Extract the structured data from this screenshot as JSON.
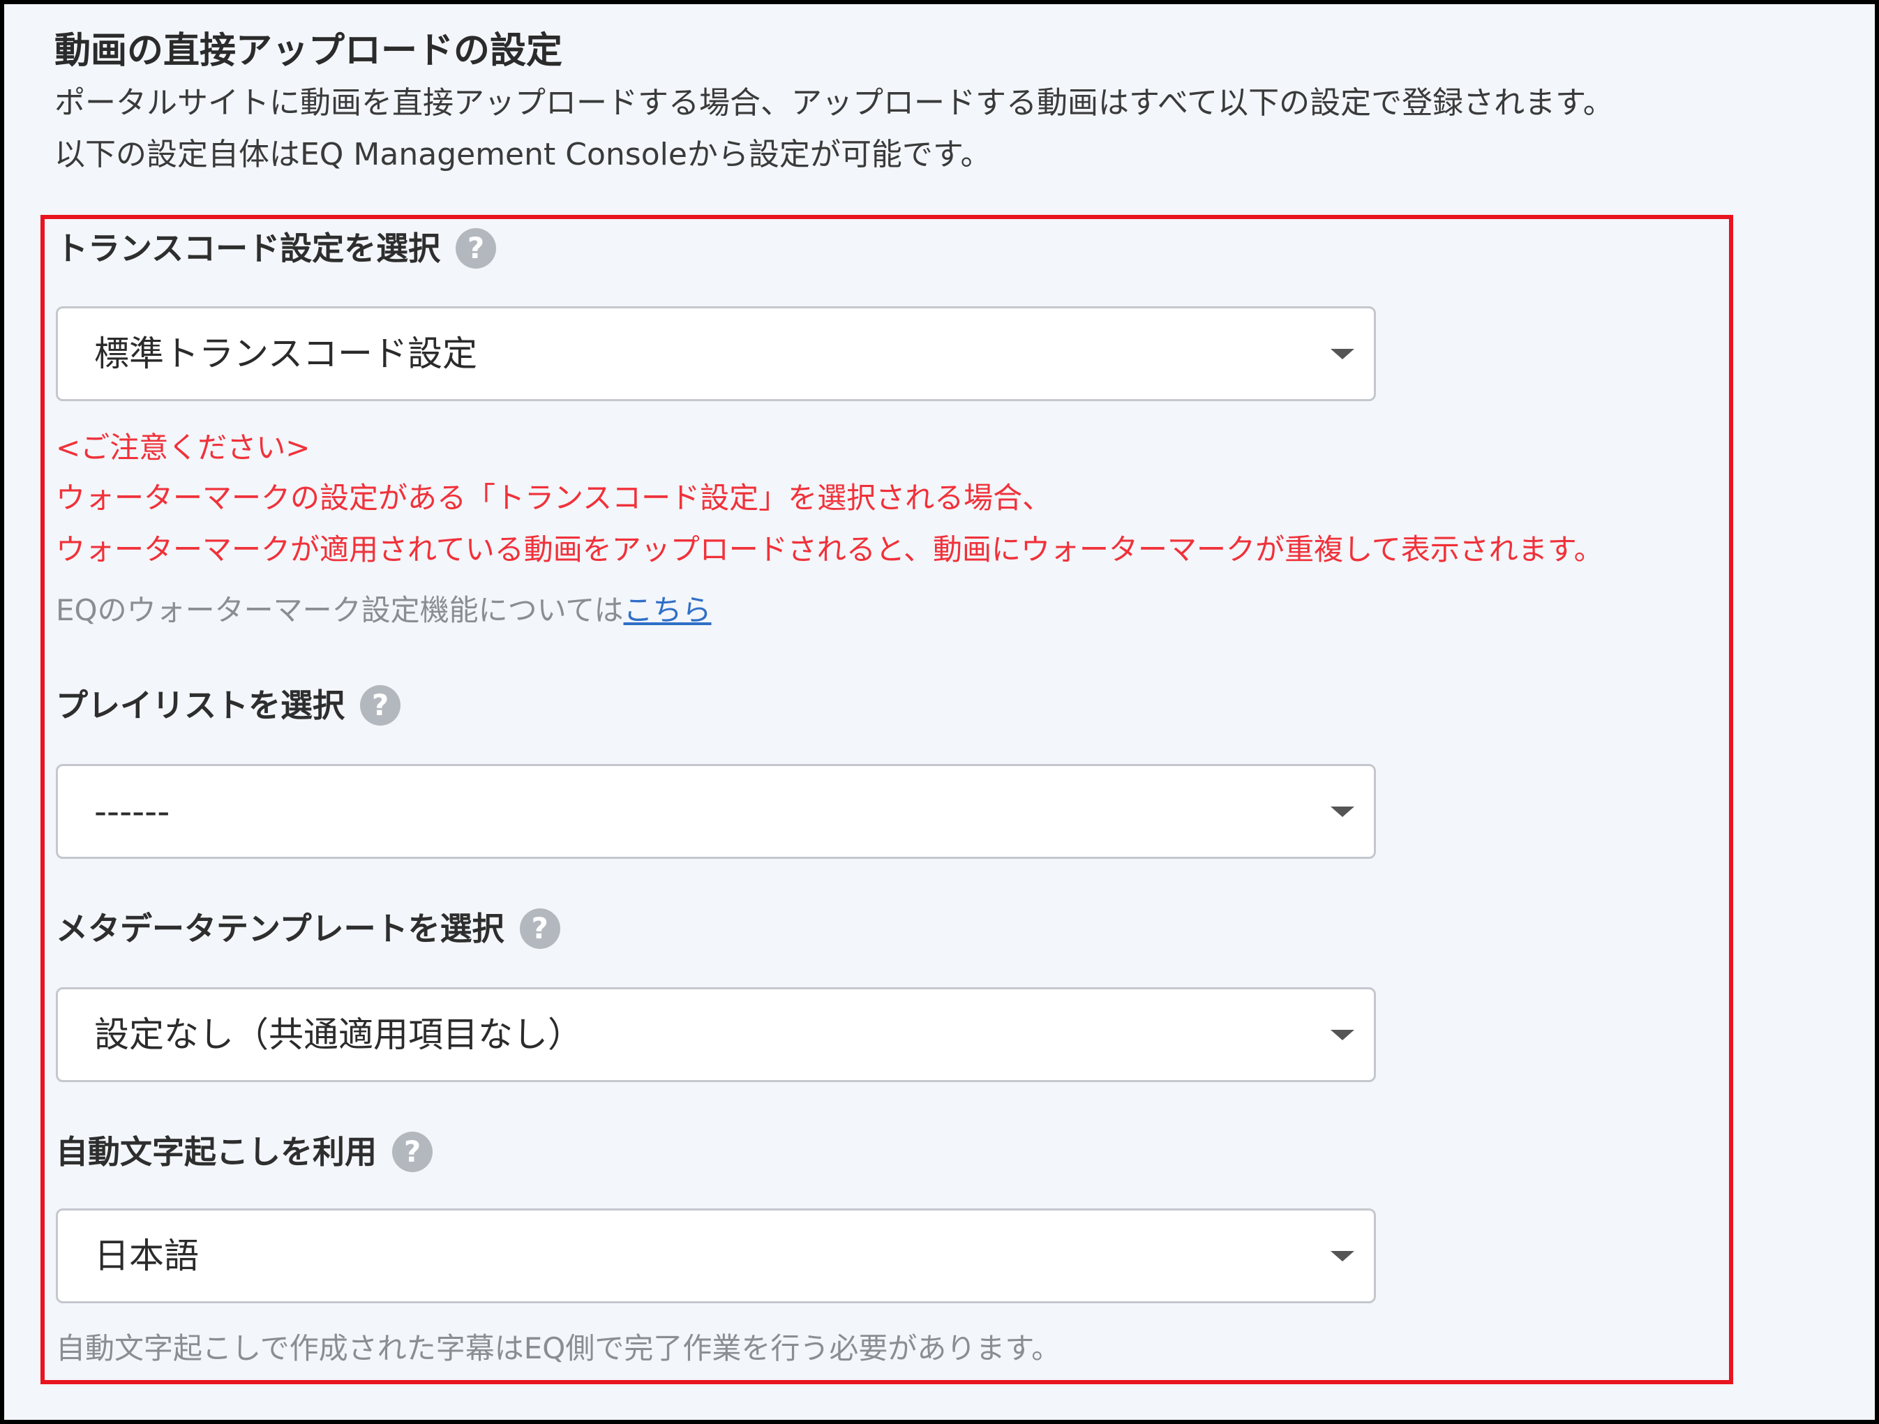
{
  "section": {
    "title": "動画の直接アップロードの設定",
    "description_line1": "ポータルサイトに動画を直接アップロードする場合、アップロードする動画はすべて以下の設定で登録されます。",
    "description_line2": "以下の設定自体はEQ Management Consoleから設定が可能です。"
  },
  "icons": {
    "help": "question-mark-circle-icon",
    "dropdown": "caret-down-icon"
  },
  "colors": {
    "highlight_border": "#e8141f",
    "warning_text": "#f0313a",
    "link": "#2f6fc8",
    "help_icon": "#b3b8be"
  },
  "fields": {
    "transcode": {
      "label": "トランスコード設定を選択",
      "help_glyph": "?",
      "value": "標準トランスコード設定",
      "warning_title": "<ご注意ください>",
      "warning_line1": "ウォーターマークの設定がある「トランスコード設定」を選択される場合、",
      "warning_line2": "ウォーターマークが適用されている動画をアップロードされると、動画にウォーターマークが重複して表示されます。",
      "note_text": "EQのウォーターマーク設定機能については",
      "note_link": "こちら"
    },
    "playlist": {
      "label": "プレイリストを選択",
      "help_glyph": "?",
      "value": "------"
    },
    "metadata_template": {
      "label": "メタデータテンプレートを選択",
      "help_glyph": "?",
      "value": "設定なし（共通適用項目なし）"
    },
    "auto_transcription": {
      "label": "自動文字起こしを利用",
      "help_glyph": "?",
      "value": "日本語",
      "note": "自動文字起こしで作成された字幕はEQ側で完了作業を行う必要があります。"
    }
  }
}
